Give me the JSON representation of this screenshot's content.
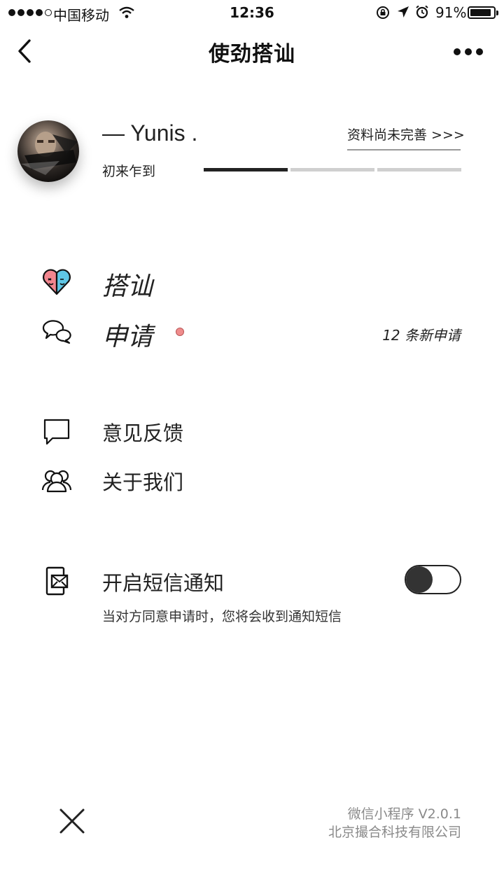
{
  "status_bar": {
    "carrier": "中国移动",
    "time": "12:36",
    "battery_percent": "91%",
    "battery_level": 0.91,
    "signal_bars_filled": 4,
    "signal_bars_total": 5,
    "icons": [
      "wifi-icon",
      "rotation-lock-icon",
      "location-arrow-icon",
      "alarm-icon",
      "battery-icon"
    ]
  },
  "nav": {
    "title": "使劲搭讪",
    "back_icon": "chevron-left-icon",
    "more_icon": "more-dots-icon"
  },
  "profile": {
    "username": "— Yunis .",
    "profile_link": "资料尚未完善  >>>",
    "level": "初来乍到",
    "progress_segments_total": 3,
    "progress_segments_filled": 1
  },
  "menu": {
    "chat_up": {
      "label": "搭讪",
      "icon": "heart-faces-icon"
    },
    "requests": {
      "label": "申请",
      "icon": "chat-bubbles-icon",
      "new_count": "12 条新申请",
      "badge_color": "#ef8c8c"
    },
    "feedback": {
      "label": "意见反馈",
      "icon": "speech-bubble-icon"
    },
    "about": {
      "label": "关于我们",
      "icon": "users-icon"
    }
  },
  "sms": {
    "label": "开启短信通知",
    "icon": "phone-mail-icon",
    "description": "当对方同意申请时，您将会收到通知短信",
    "enabled": false
  },
  "footer": {
    "close_icon": "close-icon",
    "version": "微信小程序  V2.0.1",
    "company": "北京撮合科技有限公司"
  },
  "colors": {
    "text": "#222222",
    "muted": "#8a8a8a",
    "badge": "#ef8c8c",
    "heart_left": "#f2868f",
    "heart_right": "#5fc6e5"
  }
}
